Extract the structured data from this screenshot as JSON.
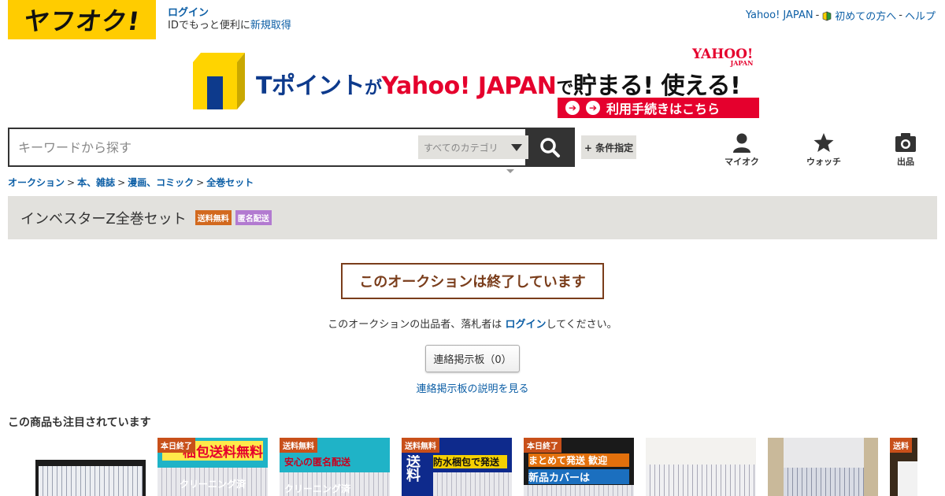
{
  "header": {
    "logo": "ヤフオク!",
    "login_label": "ログイン",
    "login_hint": "IDでもっと便利に",
    "signup_link": "新規取得",
    "yahoo_japan": "Yahoo! JAPAN",
    "dash1": "-",
    "beginners": "初めての方へ",
    "dash2": "-",
    "help": "ヘルプ"
  },
  "banner": {
    "tpoint": "Tポイント",
    "ga": "が",
    "yahoo_japan": "Yahoo! JAPAN",
    "de": "で",
    "slogan": "貯まる! 使える!",
    "mini_logo": "YAHOO!",
    "mini_logo_sub": "JAPAN",
    "cta": "利用手続きはこちら"
  },
  "search": {
    "placeholder": "キーワードから探す",
    "category": "すべてのカテゴリ",
    "conditions": "+ 条件指定"
  },
  "nav": {
    "myauction": "マイオク",
    "watch": "ウォッチ",
    "sell": "出品"
  },
  "breadcrumb": {
    "items": [
      "オークション",
      "本、雑誌",
      "漫画、コミック",
      "全巻セット"
    ],
    "sep": ">"
  },
  "item": {
    "title": "インベスターZ全巻セット",
    "badge_shipping": "送料無料",
    "badge_anonymous": "匿名配送"
  },
  "status": {
    "ended": "このオークションは終了しています",
    "login_msg_before": "このオークションの出品者、落札者は ",
    "login_link": "ログイン",
    "login_msg_after": "してください。",
    "board_button": "連絡掲示板（0）",
    "board_help": "連絡掲示板の説明を見る"
  },
  "recommend": {
    "title": "この商品も注目されています",
    "items": [
      {
        "tag": ""
      },
      {
        "tag": "本日終了",
        "caption1": "梱包送料無料",
        "caption2": "クリーニング済"
      },
      {
        "tag": "送料無料",
        "caption1": "安心の匿名配送",
        "caption2": "クリーニング済"
      },
      {
        "tag": "送料無料",
        "caption1": "防水梱包で発送",
        "caption2": "送料"
      },
      {
        "tag": "本日終了",
        "caption1": "まとめて発送 歓迎",
        "caption2": "新品カバーは"
      },
      {
        "tag": ""
      },
      {
        "tag": ""
      },
      {
        "tag": "送料"
      }
    ]
  },
  "colors": {
    "brand_yellow": "#ffcc00",
    "link_blue": "#0d5fa6",
    "ended_brown": "#7a3d1b",
    "title_bar_bg": "#e2e1dd"
  }
}
